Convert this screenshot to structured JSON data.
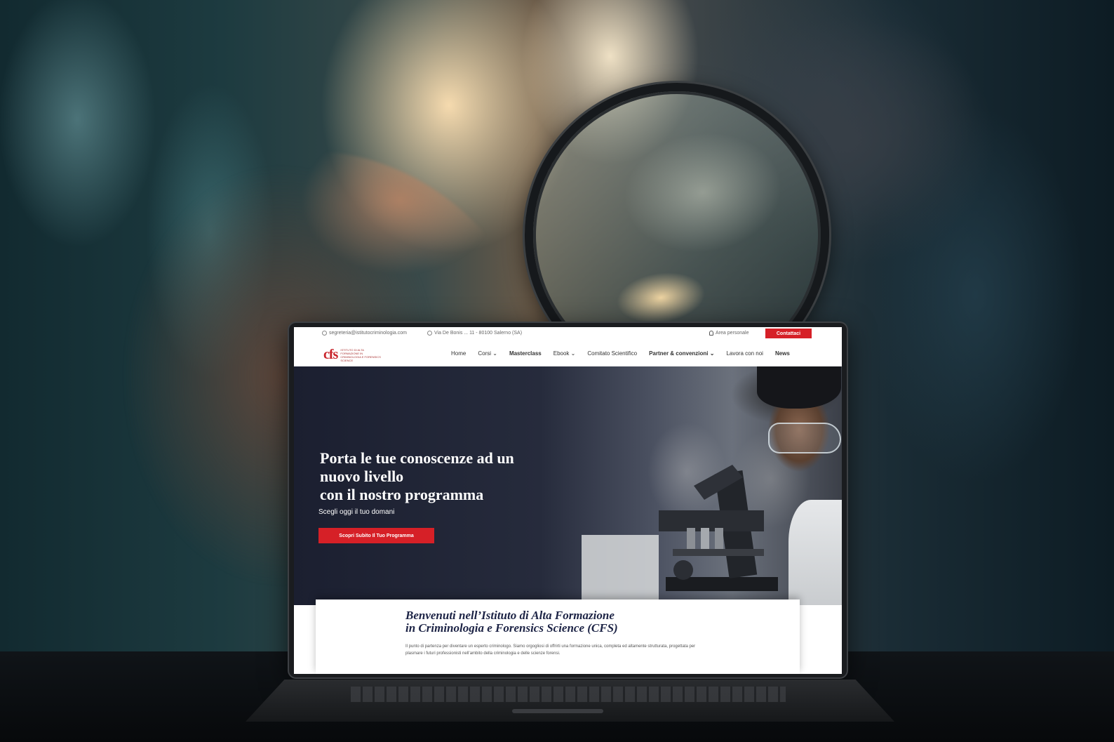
{
  "topbar": {
    "email": "segreteria@istitutocriminologia.com",
    "address": "Via De Bonis ... 11 - 80100 Salerno (SA)",
    "area_personale": "Area personale",
    "contact_button": "Contattaci"
  },
  "logo": {
    "mark": "cfs",
    "tagline": "ISTITUTO DI ALTA FORMAZIONE IN CRIMINOLOGIA E FORENSICS SCIENCE"
  },
  "nav": {
    "items": [
      "Home",
      "Corsi ⌄",
      "Masterclass",
      "Ebook ⌄",
      "Comitato Scientifico",
      "Partner & convenzioni ⌄",
      "Lavora con noi",
      "News"
    ]
  },
  "hero": {
    "title_line1": "Porta le tue conoscenze ad un",
    "title_line2": "nuovo livello",
    "title_line3": "con il nostro programma",
    "subtitle": "Scegli oggi il tuo domani",
    "cta": "Scopri Subito Il Tuo Programma"
  },
  "welcome": {
    "title_line1": "Benvenuti nell’Istituto di Alta Formazione",
    "title_line2": "in Criminologia e Forensics Science (CFS)",
    "body": "Il punto di partenza per diventare un esperto criminologo. Siamo orgogliosi di offrirti una formazione unica, completa ed altamente strutturata, progettata per plasmare i futuri professionisti nell’ambito della criminologia e delle scienze forensi."
  },
  "colors": {
    "accent": "#d62027",
    "title_navy": "#1c2345"
  }
}
